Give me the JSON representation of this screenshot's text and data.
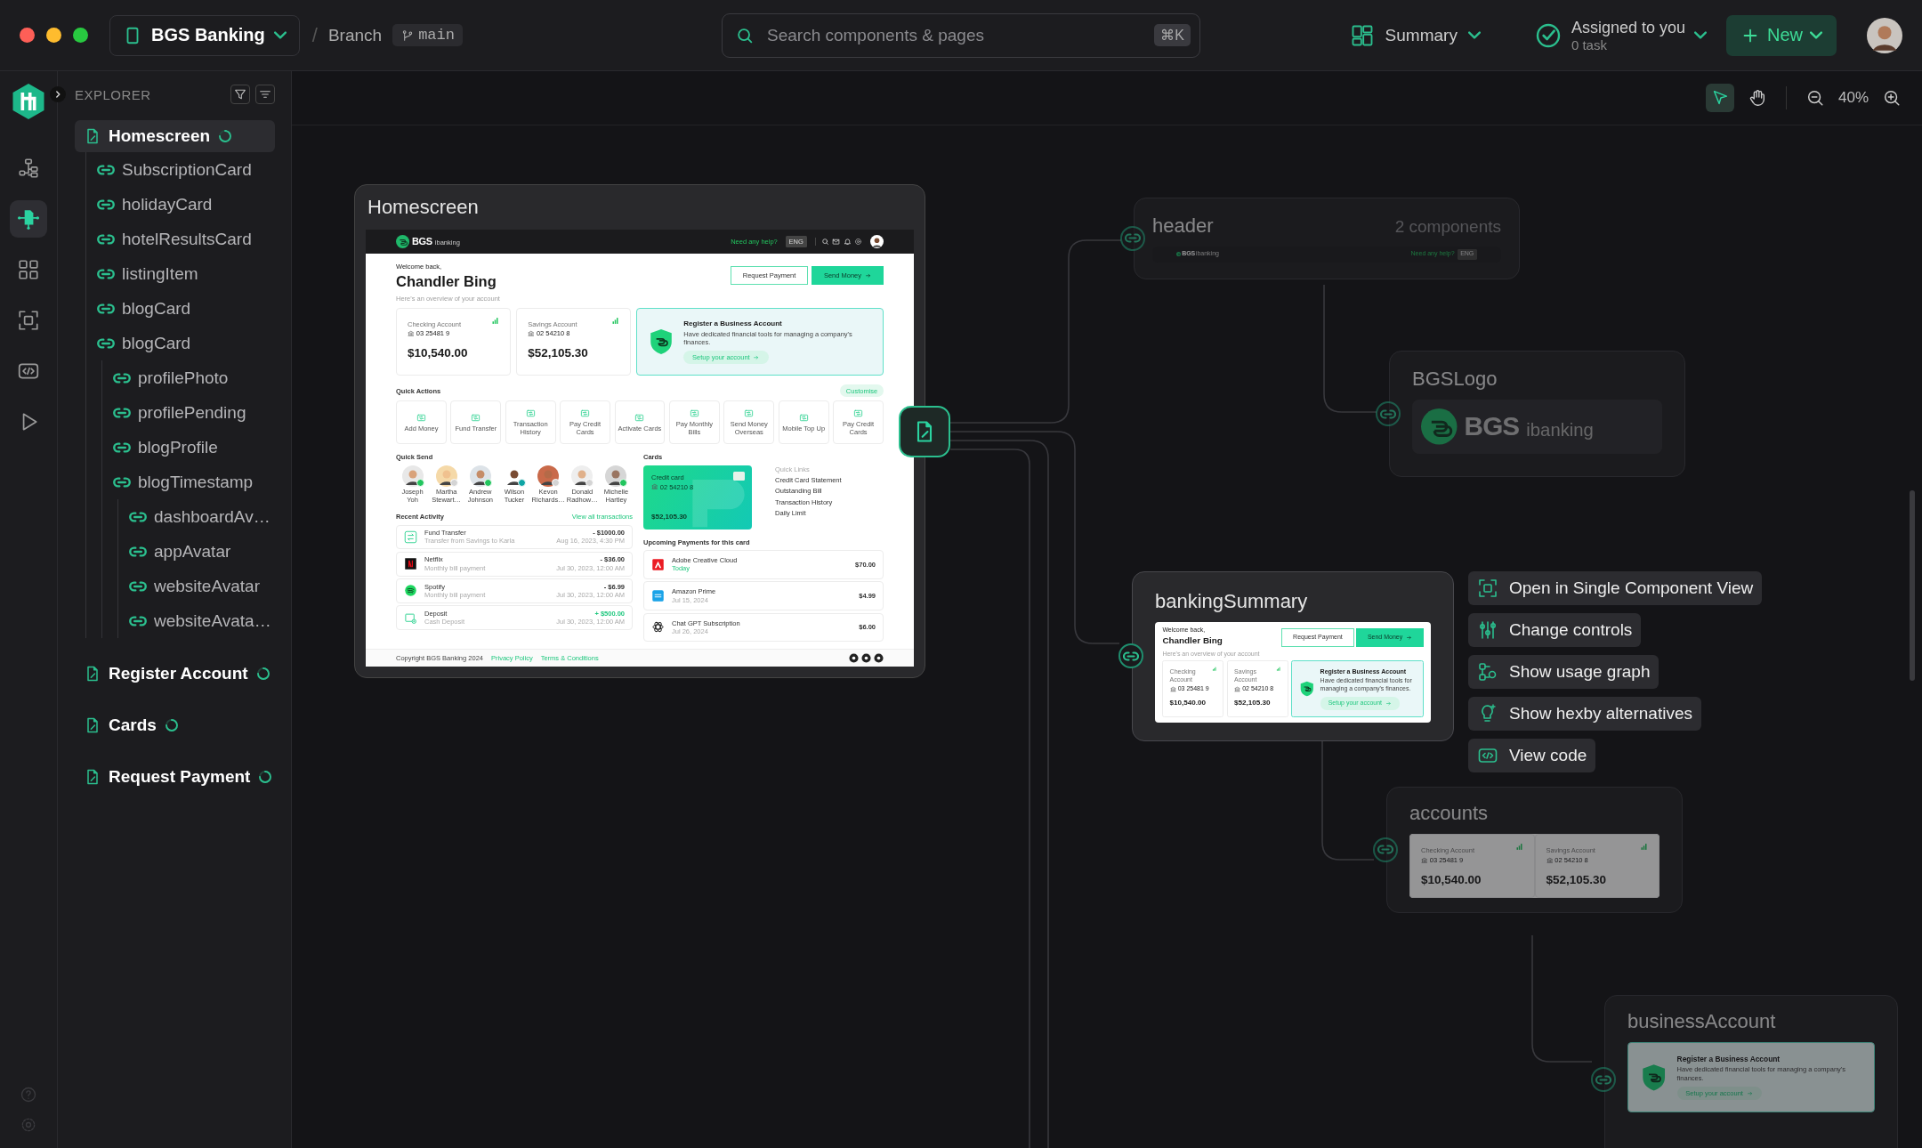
{
  "titlebar": {
    "project": "BGS Banking",
    "separator": "/",
    "branch_label": "Branch",
    "branch": "main",
    "search": {
      "placeholder": "Search components & pages",
      "shortcut": "⌘K"
    },
    "view": "Summary",
    "assigned": {
      "title": "Assigned to you",
      "count": "0 task"
    },
    "new_button": "New"
  },
  "rail": [
    {
      "kind": "hierarchy",
      "selected": false
    },
    {
      "kind": "component",
      "selected": true
    },
    {
      "kind": "grid",
      "selected": false
    },
    {
      "kind": "frame",
      "selected": false
    },
    {
      "kind": "code",
      "selected": false
    },
    {
      "kind": "play",
      "selected": false
    }
  ],
  "explorer": {
    "title": "EXPLORER",
    "tree": [
      {
        "label": "Homescreen",
        "kind": "page",
        "selected": true,
        "loading": true,
        "children": [
          {
            "label": "SubscriptionCard",
            "kind": "component",
            "selected": false
          },
          {
            "label": "holidayCard",
            "kind": "component",
            "selected": false
          },
          {
            "label": "hotelResultsCard",
            "kind": "component",
            "selected": false
          },
          {
            "label": "listingItem",
            "kind": "component",
            "selected": false
          },
          {
            "label": "blogCard",
            "kind": "component",
            "selected": false
          },
          {
            "label": "blogCard",
            "kind": "component",
            "selected": false,
            "children": [
              {
                "label": "profilePhoto",
                "kind": "component",
                "selected": false
              },
              {
                "label": "profilePending",
                "kind": "component",
                "selected": false
              },
              {
                "label": "blogProfile",
                "kind": "component",
                "selected": false
              },
              {
                "label": "blogTimestamp",
                "kind": "component",
                "selected": false,
                "children": [
                  {
                    "label": "dashboardAv…",
                    "kind": "component",
                    "selected": false
                  },
                  {
                    "label": "appAvatar",
                    "kind": "component",
                    "selected": false
                  },
                  {
                    "label": "websiteAvatar",
                    "kind": "component",
                    "selected": false
                  },
                  {
                    "label": "websiteAvata…",
                    "kind": "component",
                    "selected": false
                  }
                ]
              }
            ]
          }
        ]
      },
      {
        "label": "Register Account",
        "kind": "page",
        "selected": false,
        "loading": true
      },
      {
        "label": "Cards",
        "kind": "page",
        "selected": false,
        "loading": true
      },
      {
        "label": "Request Payment",
        "kind": "page",
        "selected": false,
        "loading": true
      }
    ]
  },
  "canvas": {
    "tools": [
      {
        "kind": "pointer",
        "selected": true
      },
      {
        "kind": "hand",
        "selected": false
      }
    ],
    "zoom": "40%",
    "screen": {
      "title": "Homescreen",
      "preview": {
        "header": {
          "logo_bold": "BGS",
          "logo_light": "ibanking",
          "help": "Need any help?",
          "language": "ENG"
        },
        "welcome": "Welcome back,",
        "name": "Chandler Bing",
        "subtitle": "Here's an overview of your account",
        "actions": [
          "Request Payment",
          "Send Money"
        ],
        "accounts": [
          {
            "label": "Checking Account",
            "number": "03 25481 9",
            "amount": "$10,540.00"
          },
          {
            "label": "Savings Account",
            "number": "02 54210 8",
            "amount": "$52,105.30"
          }
        ],
        "business": {
          "title": "Register a Business Account",
          "description": "Have dedicated financial tools for managing a company's finances.",
          "link": "Setup your account"
        },
        "quick_actions": {
          "title": "Quick Actions",
          "customise": "Customise",
          "items": [
            "Add Money",
            "Fund Transfer",
            "Transaction History",
            "Pay Credit Cards",
            "Activate Cards",
            "Pay Monthly Bills",
            "Send Money Overseas",
            "Mobile Top Up",
            "Pay Credit Cards"
          ]
        },
        "quick_send": {
          "title": "Quick Send",
          "people": [
            {
              "name": "Joseph Yoh",
              "color": "#22c55e"
            },
            {
              "name": "Martha Stewart…",
              "color": "#d4d4d4"
            },
            {
              "name": "Andrew Johnson",
              "color": "#22c55e"
            },
            {
              "name": "Wilson Tucker",
              "color": "#0ea5a5"
            },
            {
              "name": "Kevon Richards…",
              "color": "#d4d4d4"
            },
            {
              "name": "Donald Radhow…",
              "color": "#d4d4d4"
            },
            {
              "name": "Michelle Hartley",
              "color": "#22c55e"
            }
          ]
        },
        "cards": {
          "title": "Cards",
          "card": {
            "label": "Credit card",
            "number": "02 54210 8",
            "amount": "$52,105.30"
          },
          "links_title": "Quick Links",
          "links": [
            "Credit Card Statement",
            "Outstanding Bill",
            "Transaction History",
            "Daily Limit"
          ]
        },
        "recent": {
          "title": "Recent Activity",
          "link": "View all transactions",
          "items": [
            {
              "kind": "transfer",
              "title": "Fund Transfer",
              "subtitle": "Transfer from Savings to Karla",
              "amount": "- $1000.00",
              "date": "Aug 16, 2023, 4:30 PM",
              "credit": false
            },
            {
              "kind": "streaming",
              "title": "Netflix",
              "subtitle": "Monthly bill payment",
              "amount": "- $36.00",
              "date": "Jul 30, 2023, 12:00 AM",
              "credit": false
            },
            {
              "kind": "music",
              "title": "Spotify",
              "subtitle": "Monthly bill payment",
              "amount": "- $6.99",
              "date": "Jul 30, 2023, 12:00 AM",
              "credit": false
            },
            {
              "kind": "deposit",
              "title": "Deposit",
              "subtitle": "Cash Deposit",
              "amount": "+ $500.00",
              "date": "Jul 30, 2023, 12:00 AM",
              "credit": true
            }
          ]
        },
        "upcoming": {
          "title": "Upcoming Payments for this card",
          "items": [
            {
              "kind": "design",
              "title": "Adobe Creative Cloud",
              "subtitle": "Today",
              "amount": "$70.00",
              "highlighted": true
            },
            {
              "kind": "video",
              "title": "Amazon Prime",
              "subtitle": "Jul 15, 2024",
              "amount": "$4.99",
              "highlighted": false
            },
            {
              "kind": "ai",
              "title": "Chat GPT Subscription",
              "subtitle": "Jul 26, 2024",
              "amount": "$6.00",
              "highlighted": false
            }
          ]
        },
        "footer": {
          "copyright": "Copyright BGS Banking 2024",
          "links": [
            "Privacy Policy",
            "Terms & Conditions"
          ]
        }
      }
    },
    "components": [
      {
        "kind": "header",
        "title": "header",
        "count": "2 components",
        "dimmed": true,
        "preview": {
          "logo_bold": "BGS",
          "logo_light": "ibanking",
          "help": "Need any help?",
          "language": "ENG"
        }
      },
      {
        "kind": "logo",
        "title": "BGSLogo",
        "dimmed": true,
        "preview": {
          "logo_bold": "BGS",
          "logo_light": "ibanking"
        }
      },
      {
        "kind": "summary",
        "title": "bankingSummary",
        "dimmed": false,
        "preview": {
          "welcome": "Welcome back,",
          "name": "Chandler Bing",
          "subtitle": "Here's an overview of your account",
          "actions": [
            "Request Payment",
            "Send Money"
          ],
          "accounts": [
            {
              "label": "Checking Account",
              "number": "03 25481 9",
              "amount": "$10,540.00"
            },
            {
              "label": "Savings Account",
              "number": "02 54210 8",
              "amount": "$52,105.30"
            }
          ],
          "business": {
            "title": "Register a Business Account",
            "description": "Have dedicated financial tools for managing a company's finances.",
            "link": "Setup your account"
          }
        }
      },
      {
        "kind": "accounts",
        "title": "accounts",
        "dimmed": true,
        "preview": {
          "accounts": [
            {
              "label": "Checking Account",
              "number": "03 25481 9",
              "amount": "$10,540.00"
            },
            {
              "label": "Savings Account",
              "number": "02 54210 8",
              "amount": "$52,105.30"
            }
          ]
        }
      },
      {
        "kind": "business",
        "title": "businessAccount",
        "dimmed": true,
        "preview": {
          "business": {
            "title": "Register a Business Account",
            "description": "Have dedicated financial tools for managing a company's finances.",
            "link": "Setup your account"
          }
        }
      }
    ],
    "menu": [
      {
        "kind": "frame",
        "label": "Open in Single Component View"
      },
      {
        "kind": "sliders",
        "label": "Change controls"
      },
      {
        "kind": "graph",
        "label": "Show usage graph"
      },
      {
        "kind": "bulb",
        "label": "Show hexby alternatives"
      },
      {
        "kind": "code",
        "label": "View code"
      }
    ]
  }
}
